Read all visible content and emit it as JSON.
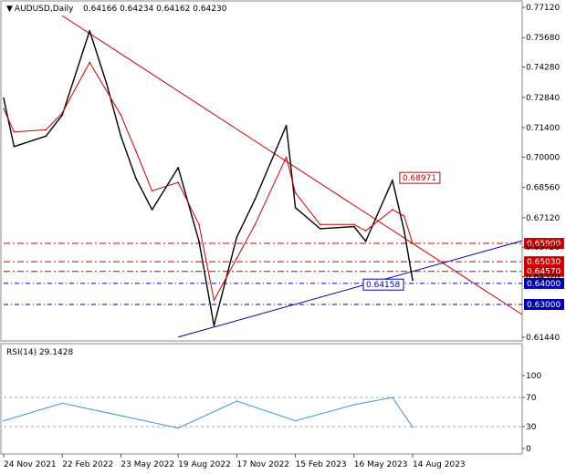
{
  "header": {
    "symbol": "AUDUSD,Daily",
    "ohlc": "0.64166 0.64234 0.64162 0.64230",
    "rsi_label": "RSI(14) 29.1428"
  },
  "chart_data": [
    {
      "type": "line",
      "title": "AUDUSD,Daily",
      "series": [
        {
          "name": "",
          "color": "#000000",
          "x": [
            "24 Nov 2021",
            "10 Dec 2021",
            "28 Jan 2022",
            "22 Feb 2022",
            "5 Apr 2022",
            "1 May 2022",
            "23 May 2022",
            "15 Jun 2022",
            "10 Jul 2022",
            "19 Aug 2022",
            "20 Sep 2022",
            "13 Oct 2022",
            "17 Nov 2022",
            "15 Dec 2022",
            "1 Feb 2023",
            "15 Feb 2023",
            "25 Mar 2023",
            "16 May 2023",
            "3 Jun 2023",
            "14 Jul 2023",
            "1 Aug 2023",
            "14 Aug 2023"
          ],
          "values": [
            0.728,
            0.705,
            0.71,
            0.72,
            0.76,
            0.735,
            0.71,
            0.69,
            0.675,
            0.695,
            0.66,
            0.62,
            0.662,
            0.68,
            0.715,
            0.676,
            0.666,
            0.667,
            0.66,
            0.689,
            0.665,
            0.6415
          ]
        },
        {
          "name": "",
          "color": "#cc0000",
          "x": [
            "24 Nov 2021",
            "10 Dec 2021",
            "28 Jan 2022",
            "22 Feb 2022",
            "5 Apr 2022",
            "23 May 2022",
            "15 Jun 2022",
            "10 Jul 2022",
            "19 Aug 2022",
            "20 Sep 2022",
            "13 Oct 2022",
            "17 Nov 2022",
            "15 Dec 2022",
            "1 Feb 2023",
            "15 Feb 2023",
            "25 Mar 2023",
            "16 May 2023",
            "3 Jun 2023",
            "14 Jul 2023",
            "1 Aug 2023",
            "14 Aug 2023"
          ],
          "values": [
            0.723,
            0.712,
            0.713,
            0.721,
            0.745,
            0.72,
            0.703,
            0.684,
            0.688,
            0.668,
            0.632,
            0.652,
            0.668,
            0.7,
            0.683,
            0.668,
            0.668,
            0.665,
            0.675,
            0.672,
            0.659
          ]
        }
      ],
      "trend_lines": [
        {
          "color": "#cc0000",
          "x": [
            "22 Feb 2022",
            "14 Aug 2023"
          ],
          "values": [
            0.7672,
            0.659
          ]
        },
        {
          "color": "#0000aa",
          "x": [
            "19 Aug 2022",
            "14 Aug 2023"
          ],
          "values": [
            0.6145,
            0.6457
          ]
        }
      ],
      "levels": [
        {
          "value": 0.659,
          "label": "0.65900",
          "color": "#cc0000"
        },
        {
          "value": 0.6503,
          "label": "0.65030",
          "color": "#cc0000"
        },
        {
          "value": 0.6457,
          "label": "0.64570",
          "color": "#cc0000"
        },
        {
          "value": 0.64,
          "label": "0.64000",
          "color": "#0000aa"
        },
        {
          "value": 0.63,
          "label": "0.63000",
          "color": "#0000aa"
        }
      ],
      "annotations": [
        {
          "text": "0.68971",
          "x": "14 Jul 2023",
          "value": 0.6897,
          "color": "#cc0000"
        },
        {
          "text": "0.64158",
          "x": "14 Aug 2023",
          "value": 0.6416,
          "color": "#0000aa"
        }
      ],
      "yticks": [
        "0.77120",
        "0.75680",
        "0.74280",
        "0.72840",
        "0.71400",
        "0.70000",
        "0.68560",
        "0.67120",
        "0.65720",
        "0.64320",
        "0.61440"
      ],
      "ylim": [
        0.6144,
        0.7712
      ],
      "xticks": [
        "24 Nov 2021",
        "22 Feb 2022",
        "23 May 2022",
        "19 Aug 2022",
        "17 Nov 2022",
        "15 Feb 2023",
        "16 May 2023",
        "14 Aug 2023"
      ]
    },
    {
      "type": "line",
      "title": "RSI(14) 29.1428",
      "series": [
        {
          "name": "",
          "color": "#3399dd",
          "x": [
            "24 Nov 2021",
            "22 Feb 2022",
            "23 May 2022",
            "19 Aug 2022",
            "17 Nov 2022",
            "15 Feb 2023",
            "16 May 2023",
            "14 Jul 2023",
            "14 Aug 2023"
          ],
          "values": [
            38,
            62,
            45,
            28,
            65,
            38,
            60,
            70,
            29.1
          ]
        }
      ],
      "yticks": [
        "100",
        "70",
        "30",
        "0"
      ],
      "levels": [
        70,
        30
      ],
      "ylim": [
        0,
        100
      ]
    }
  ]
}
